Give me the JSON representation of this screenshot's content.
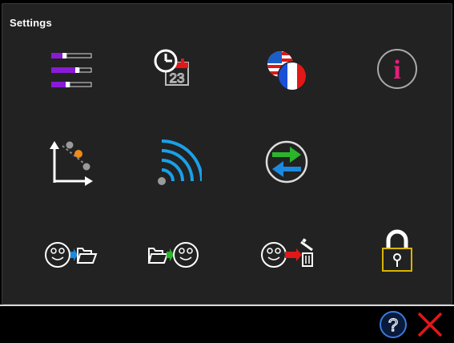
{
  "window": {
    "title": "Settings"
  },
  "colors": {
    "panel_bg": "#222222",
    "purple": "#8a1ad8",
    "blue": "#1a9be0",
    "green": "#2ab52a",
    "red": "#e01818",
    "orange": "#f08a1a",
    "pink": "#e0207a",
    "gold": "#d8b400",
    "gray": "#9a9a9a"
  },
  "tiles": [
    {
      "name": "levels",
      "icon": "level-bars-icon"
    },
    {
      "name": "date-time",
      "icon": "clock-calendar-icon",
      "calendar_day": "23"
    },
    {
      "name": "language",
      "icon": "flags-icon"
    },
    {
      "name": "info",
      "icon": "info-icon",
      "glyph": "i"
    },
    {
      "name": "calibration",
      "icon": "calibration-curve-icon"
    },
    {
      "name": "wireless",
      "icon": "wifi-signal-icon"
    },
    {
      "name": "sync",
      "icon": "sync-arrows-icon"
    },
    {
      "name": "unknown-blank",
      "icon": ""
    },
    {
      "name": "export-to-folder",
      "icon": "smiley-to-folder-icon"
    },
    {
      "name": "import-from-folder",
      "icon": "folder-to-smiley-icon"
    },
    {
      "name": "delete-data",
      "icon": "smiley-to-trash-icon"
    },
    {
      "name": "lock",
      "icon": "padlock-icon"
    }
  ],
  "footer": {
    "help": {
      "icon": "help-icon",
      "glyph": "?"
    },
    "close": {
      "icon": "close-icon"
    }
  }
}
